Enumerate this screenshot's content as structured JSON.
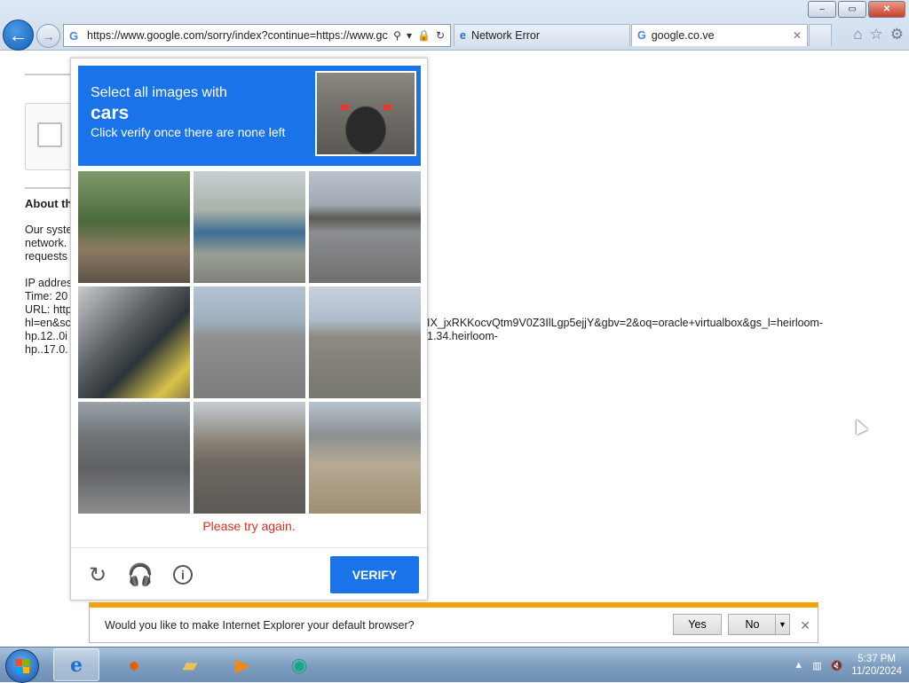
{
  "browser": {
    "url": "https://www.google.com/sorry/index?continue=https://www.gc",
    "tabs": [
      {
        "label": "Network Error",
        "icon": "ie-icon"
      },
      {
        "label": "google.co.ve",
        "icon": "google-icon"
      }
    ],
    "window_controls": {
      "minimize": "–",
      "maximize": "▭",
      "close": "✕"
    }
  },
  "page": {
    "about_heading": "About th",
    "paragraph_lines": [
      "Our syste",
      "network.",
      "requests"
    ],
    "ip_lines": [
      "IP addres",
      "Time: 20",
      "URL: http",
      "hl=en&sc",
      "hp.12..0i",
      "hp..17.0."
    ],
    "url_overflow_line1": "IX_jxRKKocvQtm9V0Z3IlLgp5ejjY&gbv=2&oq=oracle+virtualbox&gs_l=heirloom-",
    "url_overflow_line2": "1.34.heirloom-"
  },
  "captcha": {
    "instruction_line1": "Select all images with",
    "target": "cars",
    "instruction_line3": "Click verify once there are none left",
    "error": "Please try again.",
    "verify_label": "VERIFY",
    "tiles": [
      "palm-trees-house",
      "palm-tree-blue-roof",
      "overpass-road",
      "traffic-light-sign",
      "wide-road-intersection",
      "road-with-streetlights",
      "street-with-cars-motorcycle",
      "city-street-traffic",
      "highway-overpass-truck"
    ]
  },
  "notification": {
    "message": "Would you like to make Internet Explorer your default browser?",
    "yes": "Yes",
    "no": "No",
    "close": "✕"
  },
  "taskbar": {
    "items": [
      "internet-explorer",
      "firefox",
      "file-explorer",
      "media-player",
      "app"
    ],
    "time": "5:37 PM",
    "date": "11/20/2024"
  }
}
